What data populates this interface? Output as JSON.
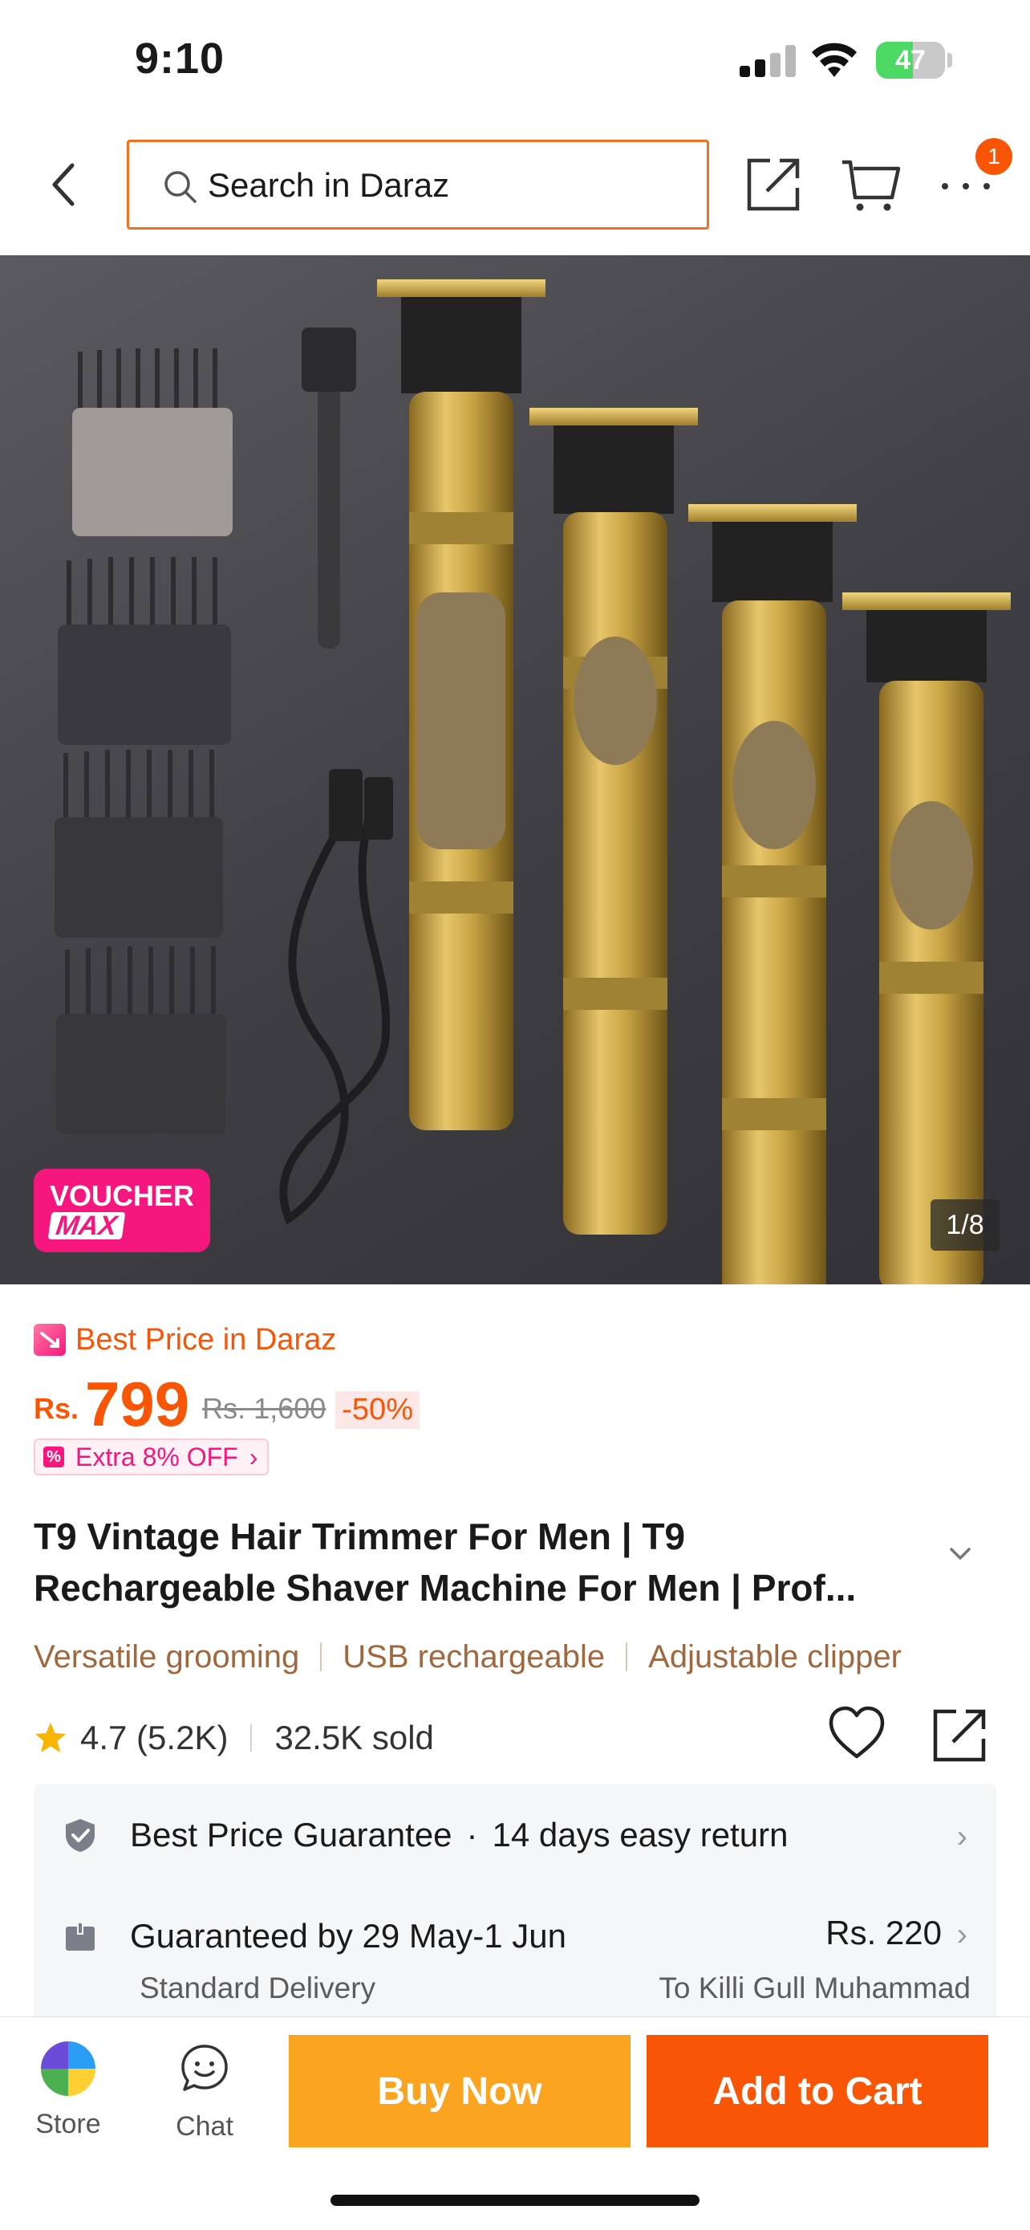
{
  "status_bar": {
    "time": "9:10",
    "battery_percent": "47",
    "icons": [
      "signal-icon",
      "wifi-icon",
      "battery-charging-icon"
    ]
  },
  "nav": {
    "back_icon": "chevron-left-icon",
    "search_placeholder": "Search in Daraz",
    "icons": [
      "share-icon",
      "cart-icon",
      "more-icon"
    ],
    "notification_count": "1"
  },
  "gallery": {
    "voucher_line1": "VOUCHER",
    "voucher_line2": "MAX",
    "counter": "1/8"
  },
  "price": {
    "badge_label": "Best Price in Daraz",
    "currency": "Rs.",
    "current": "799",
    "original": "Rs. 1,600",
    "discount": "-50%",
    "extra_offer": "Extra 8% OFF"
  },
  "product": {
    "title": "T9 Vintage Hair Trimmer For Men | T9 Rechargeable Shaver Machine For Men | Prof...",
    "features": [
      "Versatile grooming",
      "USB rechargeable",
      "Adjustable clipper"
    ],
    "rating": "4.7 (5.2K)",
    "sold": "32.5K sold"
  },
  "service": {
    "guarantee": "Best Price Guarantee",
    "returns": "14 days easy return",
    "delivery_date": "Guaranteed by 29 May-1 Jun",
    "delivery_fee": "Rs. 220",
    "delivery_type": "Standard Delivery",
    "delivery_location": "To Killi Gull Muhammad"
  },
  "bottom_bar": {
    "store_label": "Store",
    "chat_label": "Chat",
    "buy_now": "Buy Now",
    "add_to_cart": "Add to Cart"
  },
  "colors": {
    "brand_orange": "#f85606",
    "buy_now_yellow": "#faa420",
    "voucher_pink": "#f5167e",
    "feature_brown": "#a0683f",
    "battery_green": "#4cd964"
  }
}
